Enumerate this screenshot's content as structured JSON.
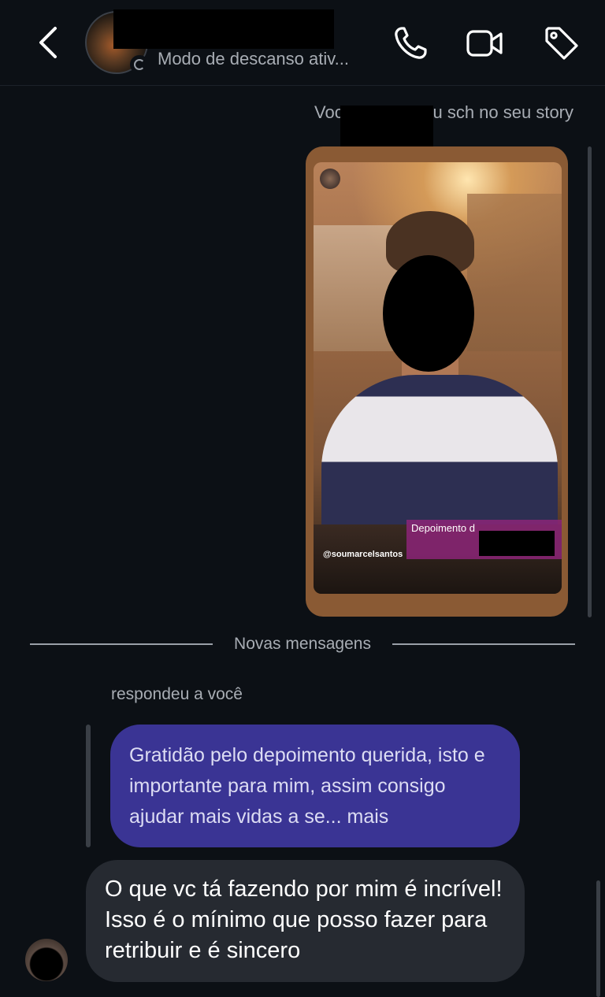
{
  "header": {
    "status": "Modo de descanso ativ...",
    "icons": {
      "back": "chevron-left-icon",
      "call": "phone-icon",
      "video": "video-camera-icon",
      "tag": "tag-icon"
    }
  },
  "story": {
    "mention_text": "Você mencionou                    sch no seu story",
    "sticker_text": "Depoimento d",
    "mention_tag": "@soumarcelsantos"
  },
  "divider": {
    "label": "Novas mensagens"
  },
  "thread": {
    "replied_label": "respondeu a você",
    "quoted_message": "Gratidão pelo depoimento querida, isto e importante para mim, assim consigo ajudar mais vidas a se... mais",
    "reply_message": "O que vc tá fazendo por mim é incrível!  Isso é o mínimo que posso fazer para retribuir e é sincero"
  },
  "colors": {
    "background": "#0c1015",
    "quoted_bubble": "#3a3494",
    "reply_bubble": "#262a31",
    "muted_text": "#a8adb4"
  }
}
